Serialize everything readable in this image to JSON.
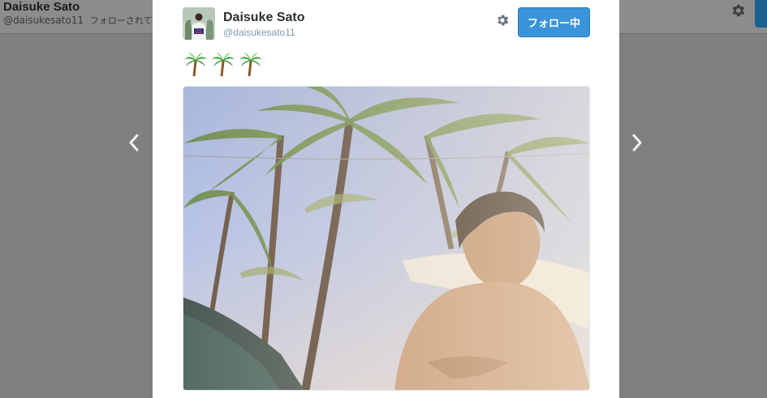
{
  "background": {
    "profile_name": "Daisuke Sato",
    "profile_handle": "@daisukesato11",
    "follows_you_text": "フォローされていま"
  },
  "navigation": {
    "prev_icon": "chevron-left-icon",
    "next_icon": "chevron-right-icon"
  },
  "tweet": {
    "author_name": "Daisuke Sato",
    "author_handle": "@daisukesato11",
    "follow_button_label": "フォロー中",
    "text_emoji": [
      "palm-tree",
      "palm-tree",
      "palm-tree"
    ],
    "settings_icon": "gear-icon"
  },
  "colors": {
    "follow_button": "#3b94d9",
    "overlay": "#7f7f7f",
    "name_text": "#292f33",
    "handle_text": "#8899a6"
  }
}
